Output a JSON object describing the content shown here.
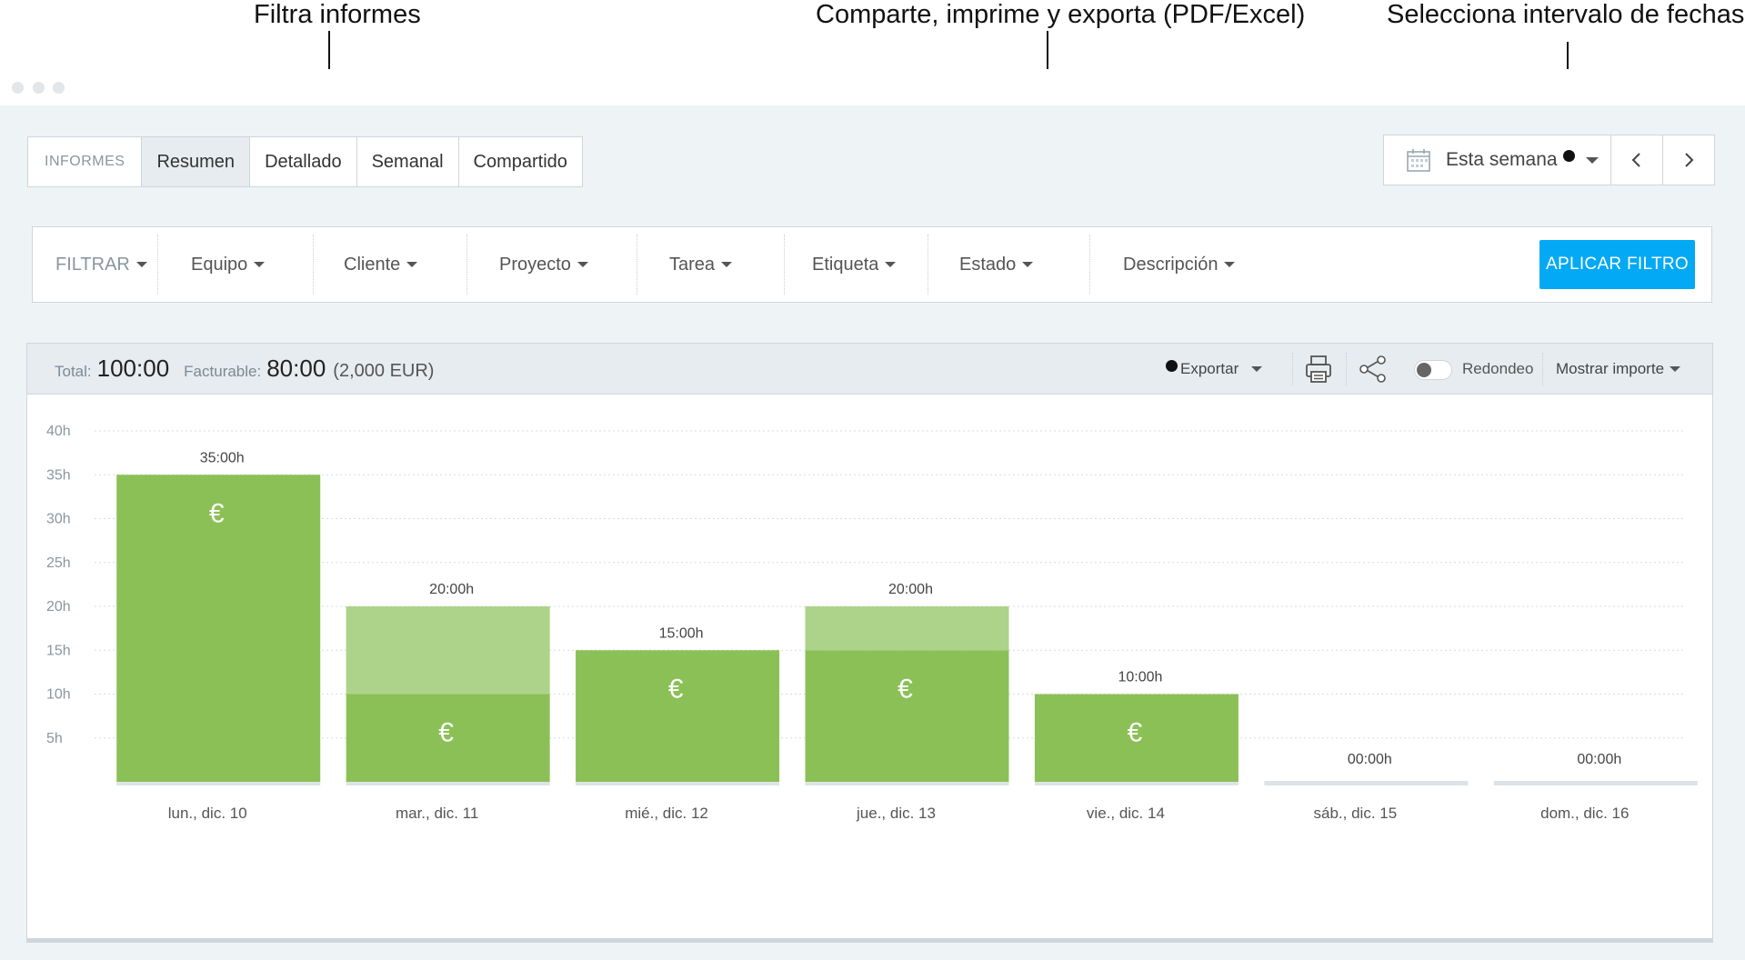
{
  "annotations": {
    "filter": "Filtra informes",
    "export": "Comparte, imprime y exporta (PDF/Excel)",
    "daterange": "Selecciona intervalo de fechas"
  },
  "tabs": {
    "section": "INFORMES",
    "items": [
      "Resumen",
      "Detallado",
      "Semanal",
      "Compartido"
    ],
    "active": "Resumen"
  },
  "daterange": {
    "label": "Esta semana",
    "prev_icon": "chevron-left-icon",
    "next_icon": "chevron-right-icon",
    "icon": "calendar-icon"
  },
  "filters": {
    "label": "FILTRAR",
    "items": [
      "Equipo",
      "Cliente",
      "Proyecto",
      "Tarea",
      "Etiqueta",
      "Estado",
      "Descripción"
    ],
    "apply": "APLICAR FILTRO",
    "apply_color": "#03a9f4"
  },
  "summary": {
    "total_label": "Total:",
    "total": "100:00",
    "billable_label": "Facturable:",
    "billable": "80:00",
    "billable_amount": "(2,000 EUR)",
    "export": "Exportar",
    "rounding": "Redondeo",
    "rounding_on": false,
    "show_amount": "Mostrar importe"
  },
  "chart_data": {
    "type": "bar",
    "stacked": true,
    "categories": [
      "lun., dic. 10",
      "mar., dic. 11",
      "mié., dic. 12",
      "jue., dic. 13",
      "vie., dic. 14",
      "sáb., dic. 15",
      "dom., dic. 16"
    ],
    "totals": [
      35,
      20,
      15,
      20,
      10,
      0,
      0
    ],
    "total_labels": [
      "35:00h",
      "20:00h",
      "15:00h",
      "20:00h",
      "10:00h",
      "00:00h",
      "00:00h"
    ],
    "series": [
      {
        "values": [
          35,
          10,
          15,
          15,
          10,
          0,
          0
        ],
        "color": "#8bc057",
        "marker": "€"
      },
      {
        "values": [
          0,
          10,
          0,
          5,
          0,
          0,
          0
        ],
        "color": "#acd389"
      }
    ],
    "ylim": [
      0,
      40
    ],
    "yticks": [
      "5h",
      "10h",
      "15h",
      "20h",
      "25h",
      "30h",
      "35h",
      "40h"
    ],
    "grid": true
  }
}
